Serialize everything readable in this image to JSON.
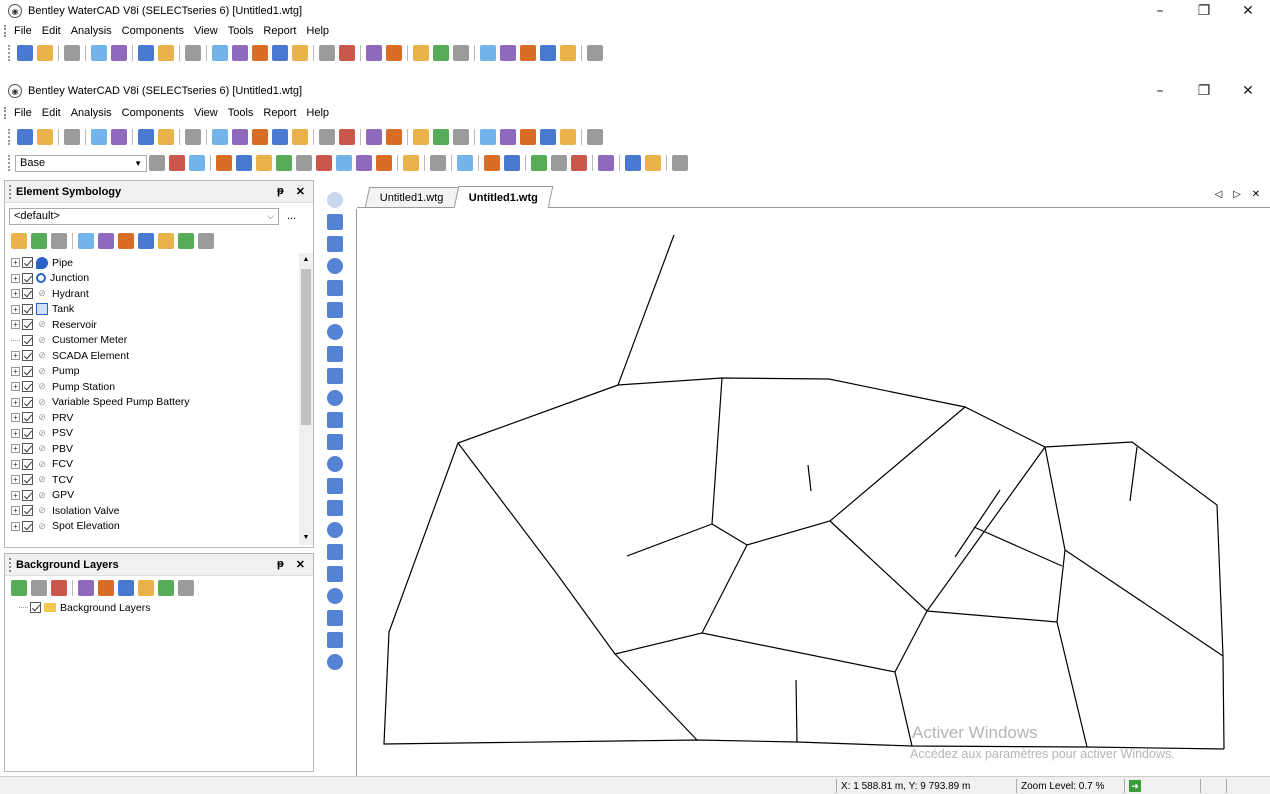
{
  "window_back": {
    "title": "Bentley WaterCAD V8i (SELECTseries 6) [Untitled1.wtg]"
  },
  "window_front": {
    "title": "Bentley WaterCAD V8i (SELECTseries 6) [Untitled1.wtg]"
  },
  "window_controls": {
    "minimize": "–",
    "maximize": "❐",
    "close": "✕"
  },
  "menu": [
    "File",
    "Edit",
    "Analysis",
    "Components",
    "View",
    "Tools",
    "Report",
    "Help"
  ],
  "scenario_combo": {
    "value": "Base"
  },
  "element_symbology": {
    "title": "Element Symbology",
    "pin": "ᵽ",
    "close": "✕",
    "dropdown_value": "<default>",
    "dropdown_more": "...",
    "items": [
      {
        "label": "Pipe",
        "icon": "pipe-icon"
      },
      {
        "label": "Junction",
        "icon": "junction-icon"
      },
      {
        "label": "Hydrant",
        "icon": "none"
      },
      {
        "label": "Tank",
        "icon": "tank-icon"
      },
      {
        "label": "Reservoir",
        "icon": "none"
      },
      {
        "label": "Customer Meter",
        "icon": "none"
      },
      {
        "label": "SCADA Element",
        "icon": "none"
      },
      {
        "label": "Pump",
        "icon": "none"
      },
      {
        "label": "Pump Station",
        "icon": "none"
      },
      {
        "label": "Variable Speed Pump Battery",
        "icon": "none"
      },
      {
        "label": "PRV",
        "icon": "none"
      },
      {
        "label": "PSV",
        "icon": "none"
      },
      {
        "label": "PBV",
        "icon": "none"
      },
      {
        "label": "FCV",
        "icon": "none"
      },
      {
        "label": "TCV",
        "icon": "none"
      },
      {
        "label": "GPV",
        "icon": "none"
      },
      {
        "label": "Isolation Valve",
        "icon": "none"
      },
      {
        "label": "Spot Elevation",
        "icon": "none"
      }
    ]
  },
  "background_layers": {
    "title": "Background Layers",
    "pin": "ᵽ",
    "close": "✕",
    "root": "Background Layers"
  },
  "drawing_tabs": [
    {
      "label": "Untitled1.wtg",
      "active": false
    },
    {
      "label": "Untitled1.wtg",
      "active": true
    }
  ],
  "tab_controls": "◁ ▷ ✕",
  "watermark": {
    "line1": "Activer Windows",
    "line2": "Accédez aux paramètres pour activer Windows."
  },
  "status": {
    "coordinates": "X: 1 588.81 m, Y: 9 793.89 m",
    "zoom": "Zoom Level: 0.7 %"
  },
  "colors": {
    "accent_blue": "#2a63c8",
    "toolbar_bg": "#ffffff",
    "panel_header": "#f0f0f0",
    "network_line": "#000000"
  }
}
